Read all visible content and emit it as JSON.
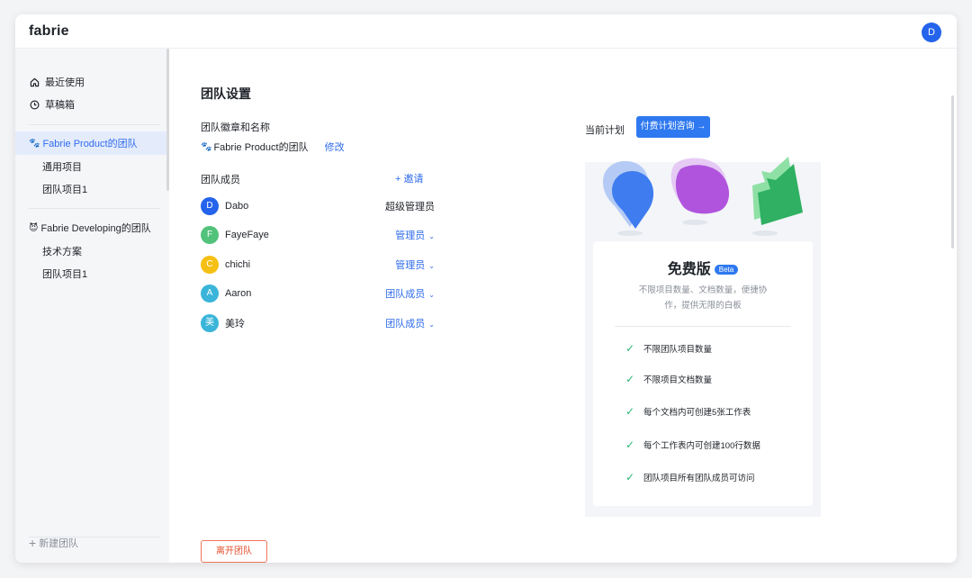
{
  "app": {
    "logo": "fabrie",
    "user_initial": "D"
  },
  "sidebar": {
    "recent": "最近使用",
    "drafts": "草稿箱",
    "teams": [
      {
        "emoji": "🐾",
        "name": "Fabrie Product的团队",
        "projects": [
          "通用项目",
          "团队项目1"
        ]
      },
      {
        "emoji": "😈",
        "name": "Fabrie Developing的团队",
        "projects": [
          "技术方案",
          "团队项目1"
        ]
      }
    ],
    "new_team": "新建团队"
  },
  "main": {
    "title": "团队设置",
    "badge_label": "团队徽章和名称",
    "team_emoji": "🐾",
    "team_name": "Fabrie Product的团队",
    "edit": "修改",
    "members_label": "团队成员",
    "invite": "+ 邀请",
    "members": [
      {
        "initial": "D",
        "name": "Dabo",
        "role": "超级管理员",
        "color": "#2463eb"
      },
      {
        "initial": "F",
        "name": "FayeFaye",
        "role": "管理员",
        "color": "#52c27b"
      },
      {
        "initial": "C",
        "name": "chichi",
        "role": "管理员",
        "color": "#f5c013"
      },
      {
        "initial": "A",
        "name": "Aaron",
        "role": "团队成员",
        "color": "#3ab5d9"
      },
      {
        "initial": "美",
        "name": "美玲",
        "role": "团队成员",
        "color": "#3ab5d9"
      }
    ],
    "leave": "离开团队"
  },
  "plan": {
    "label": "当前计划",
    "consult": "付费计划咨询 →",
    "name": "免费版",
    "beta": "Beta",
    "desc": "不限项目数量、文档数量，便捷协作，提供无限的白板",
    "features": [
      "不限团队项目数量",
      "不限项目文档数量",
      "每个文档内可创建5张工作表",
      "每个工作表内可创建100行数据",
      "团队项目所有团队成员可访问"
    ]
  },
  "colors": {
    "accent": "#2f6bea",
    "danger": "#e4502e",
    "check": "#2bb673"
  }
}
